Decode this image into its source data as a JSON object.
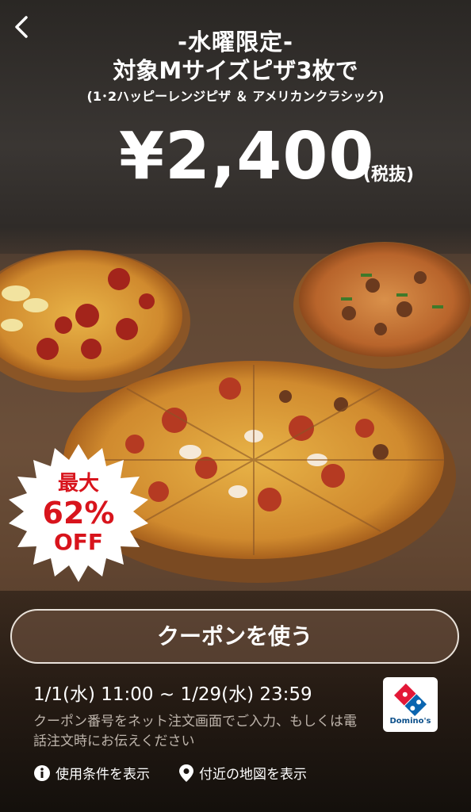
{
  "header": {
    "line1": "-水曜限定-",
    "line2": "対象Mサイズピザ3枚で",
    "line3": "(1･2ハッピーレンジピザ ＆ アメリカンクラシック)"
  },
  "price": {
    "amount": "¥2,400",
    "tax_note": "(税抜)"
  },
  "badge": {
    "line1": "最大",
    "line2": "62%",
    "line3": "OFF"
  },
  "coupon_button_label": "クーポンを使う",
  "validity_period": "1/1(水) 11:00 ~ 1/29(水) 23:59",
  "usage_note": "クーポン番号をネット注文画面でご入力、もしくは電話注文時にお伝えください",
  "brand": {
    "name": "Domino's",
    "color_blue": "#0b65b0",
    "color_red": "#e31837"
  },
  "links": {
    "terms": "使用条件を表示",
    "map": "付近の地図を表示"
  },
  "icons": {
    "back": "chevron-left-icon",
    "info": "info-icon",
    "location": "location-pin-icon"
  }
}
